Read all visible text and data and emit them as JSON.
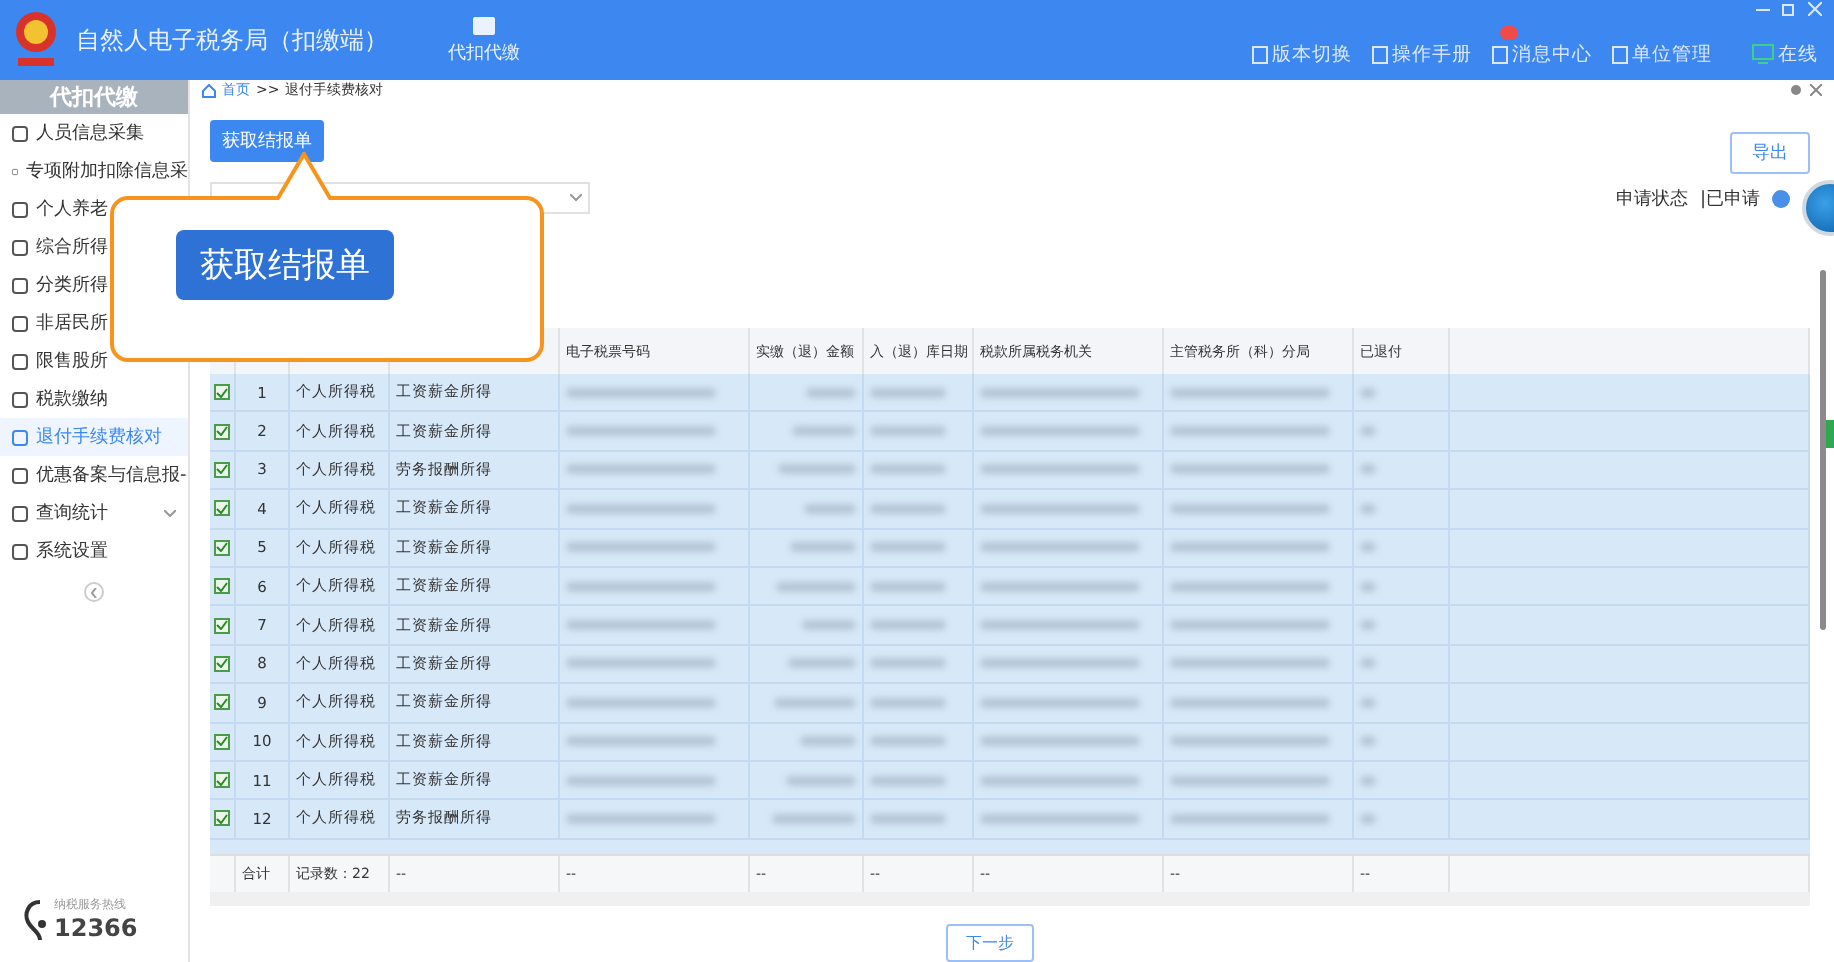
{
  "app": {
    "title": "自然人电子税务局（扣缴端）",
    "nav_tab": "代扣代缴"
  },
  "top_links": [
    {
      "kind": "plain",
      "label": "版本切换"
    },
    {
      "kind": "plain",
      "label": "操作手册"
    },
    {
      "kind": "badge",
      "label": "消息中心"
    },
    {
      "kind": "plain",
      "label": "单位管理"
    },
    {
      "kind": "status",
      "label": "在线"
    }
  ],
  "sidebar": {
    "title": "代扣代缴",
    "items": [
      {
        "label": "人员信息采集",
        "selected": false
      },
      {
        "label": "专项附加扣除信息采",
        "selected": false
      },
      {
        "label": "个人养老",
        "selected": false
      },
      {
        "label": "综合所得",
        "selected": false
      },
      {
        "label": "分类所得",
        "selected": false
      },
      {
        "label": "非居民所",
        "selected": false
      },
      {
        "label": "限售股所",
        "selected": false
      },
      {
        "label": "税款缴纳",
        "selected": false
      },
      {
        "label": "退付手续费核对",
        "selected": true
      },
      {
        "label": "优惠备案与信息报-",
        "selected": false
      },
      {
        "label": "查询统计",
        "selected": false,
        "expandable": true
      },
      {
        "label": "系统设置",
        "selected": false
      }
    ],
    "hotline_caption": "纳税服务热线",
    "hotline": "12366"
  },
  "breadcrumb": {
    "home": "首页",
    "separator": ">>",
    "current": "退付手续费核对"
  },
  "fetch_button": "获取结报单",
  "export_button": "导出",
  "status": {
    "label": "申请状态",
    "value": "|已申请"
  },
  "callout": {
    "text": "获取结报单"
  },
  "table": {
    "columns": [
      "电子税票号码",
      "实缴（退）金额",
      "入（退）库日期",
      "税款所属税务机关",
      "主管税务所（科）分局",
      "已退付"
    ],
    "rows": [
      {
        "checked": true,
        "index": "1",
        "item": "个人所得税",
        "category": "工资薪金所得"
      },
      {
        "checked": true,
        "index": "2",
        "item": "个人所得税",
        "category": "工资薪金所得"
      },
      {
        "checked": true,
        "index": "3",
        "item": "个人所得税",
        "category": "劳务报酬所得"
      },
      {
        "checked": true,
        "index": "4",
        "item": "个人所得税",
        "category": "工资薪金所得"
      },
      {
        "checked": true,
        "index": "5",
        "item": "个人所得税",
        "category": "工资薪金所得"
      },
      {
        "checked": true,
        "index": "6",
        "item": "个人所得税",
        "category": "工资薪金所得"
      },
      {
        "checked": true,
        "index": "7",
        "item": "个人所得税",
        "category": "工资薪金所得"
      },
      {
        "checked": true,
        "index": "8",
        "item": "个人所得税",
        "category": "工资薪金所得"
      },
      {
        "checked": true,
        "index": "9",
        "item": "个人所得税",
        "category": "工资薪金所得"
      },
      {
        "checked": true,
        "index": "10",
        "item": "个人所得税",
        "category": "工资薪金所得"
      },
      {
        "checked": true,
        "index": "11",
        "item": "个人所得税",
        "category": "工资薪金所得"
      },
      {
        "checked": true,
        "index": "12",
        "item": "个人所得税",
        "category": "劳务报酬所得"
      }
    ],
    "footer": [
      "合计",
      "记录数：22",
      "--",
      "--",
      "--",
      "--",
      "--",
      "--",
      "--"
    ]
  },
  "next_button": "下一步"
}
